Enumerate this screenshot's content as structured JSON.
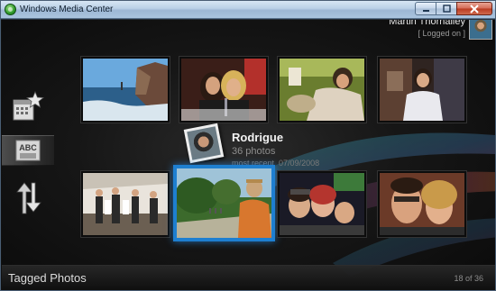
{
  "window": {
    "title": "Windows Media Center"
  },
  "user": {
    "name": "Martin Thornalley",
    "status": "[ Logged on ]"
  },
  "nav": [
    {
      "icon": "calendar-star-icon"
    },
    {
      "icon": "abc-sort-icon",
      "label": "ABC",
      "selected": true
    },
    {
      "icon": "sort-arrows-icon"
    }
  ],
  "info": {
    "name": "Rodrigue",
    "count": "36 photos",
    "recent_label": "most recent",
    "recent_date": "07/09/2008"
  },
  "footer": {
    "title": "Tagged Photos",
    "pagination": "18 of 36"
  },
  "accent_color": "#1e7fd0"
}
